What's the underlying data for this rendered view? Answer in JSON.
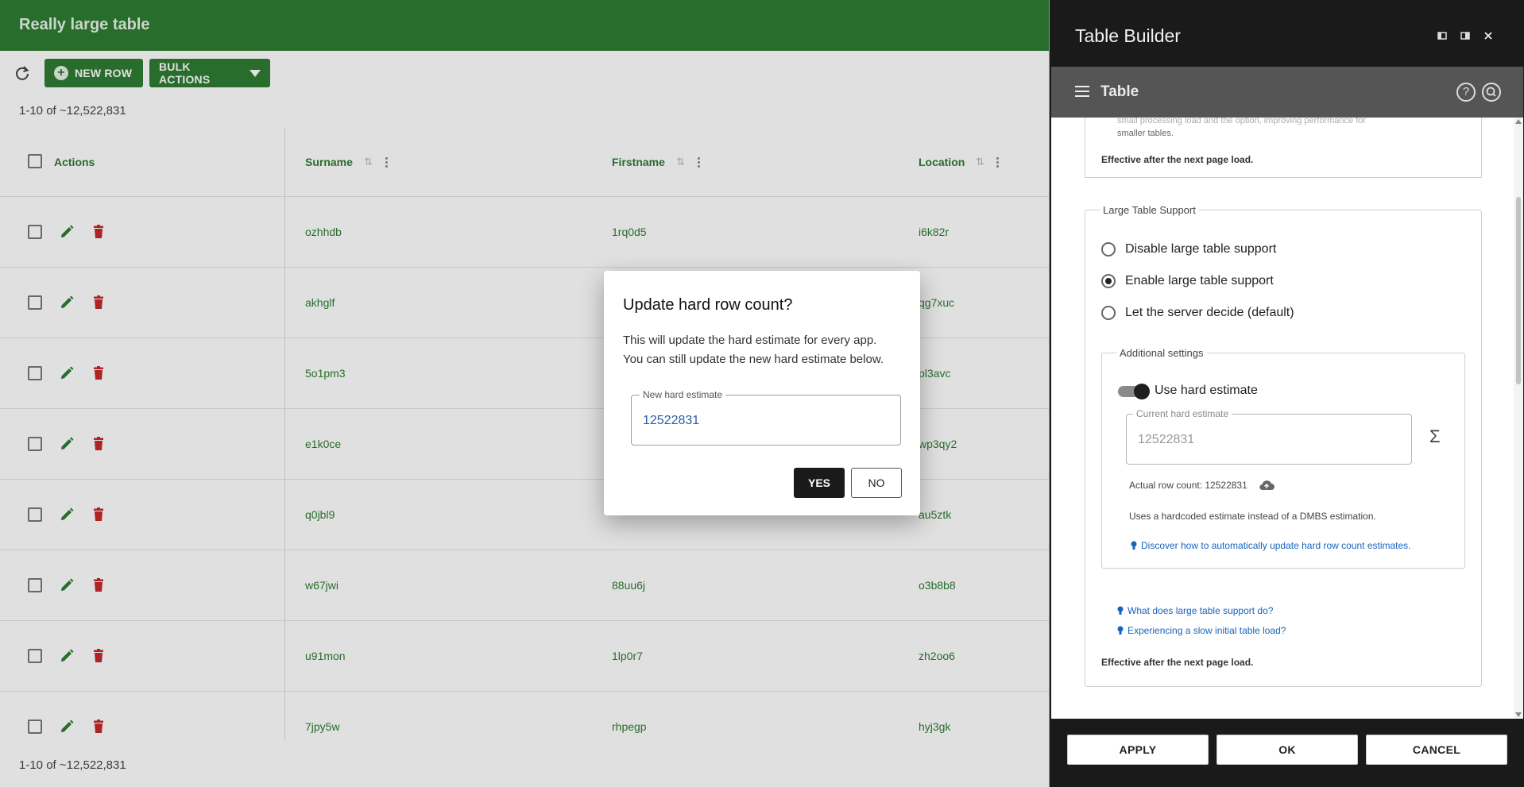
{
  "app": {
    "title": "Really large table"
  },
  "toolbar": {
    "new_row": "NEW ROW",
    "bulk_actions": "BULK ACTIONS"
  },
  "pagination": {
    "range_top": "1-10 of ~12,522,831",
    "range_bottom": "1-10 of ~12,522,831"
  },
  "table": {
    "headers": {
      "actions": "Actions",
      "surname": "Surname",
      "firstname": "Firstname",
      "location": "Location"
    },
    "rows": [
      {
        "surname": "ozhhdb",
        "firstname": "1rq0d5",
        "location": "i6k82r"
      },
      {
        "surname": "akhglf",
        "firstname": "",
        "location": "qg7xuc"
      },
      {
        "surname": "5o1pm3",
        "firstname": "",
        "location": "pl3avc"
      },
      {
        "surname": "e1k0ce",
        "firstname": "",
        "location": "wp3qy2"
      },
      {
        "surname": "q0jbl9",
        "firstname": "",
        "location": "au5ztk"
      },
      {
        "surname": "w67jwi",
        "firstname": "88uu6j",
        "location": "o3b8b8"
      },
      {
        "surname": "u91mon",
        "firstname": "1lp0r7",
        "location": "zh2oo6"
      },
      {
        "surname": "7jpy5w",
        "firstname": "rhpegp",
        "location": "hyj3gk"
      }
    ]
  },
  "dialog": {
    "title": "Update hard row count?",
    "message_line1": "This will update the hard estimate for every app.",
    "message_line2": "You can still update the new hard estimate below.",
    "field_label": "New hard estimate",
    "field_value": "12522831",
    "yes": "YES",
    "no": "NO"
  },
  "panel": {
    "title": "Table Builder",
    "section": "Table",
    "clipped_line1": "small processing load and the option, improving performance for",
    "clipped_line2": "smaller tables.",
    "effective_top": "Effective after the next page load.",
    "large_table": {
      "legend": "Large Table Support",
      "options": [
        "Disable large table support",
        "Enable large table support",
        "Let the server decide (default)"
      ],
      "selected": 1
    },
    "additional": {
      "legend": "Additional settings",
      "toggle_label": "Use hard estimate",
      "toggle_on": true,
      "current_label": "Current hard estimate",
      "current_value": "12522831",
      "actual_row_count": "Actual row count: 12522831",
      "explanation": "Uses a hardcoded estimate instead of a DMBS estimation.",
      "discover_link": "Discover how to automatically update hard row count estimates."
    },
    "links": {
      "what_does": "What does large table support do?",
      "slow_load": "Experiencing a slow initial table load?"
    },
    "effective_bottom": "Effective after the next page load.",
    "footer": {
      "apply": "APPLY",
      "ok": "OK",
      "cancel": "CANCEL"
    }
  },
  "colors": {
    "brand_green": "#2e7d32",
    "delete_red": "#c62828",
    "link_blue": "#1565c0",
    "panel_dark": "#1a1a1a"
  }
}
